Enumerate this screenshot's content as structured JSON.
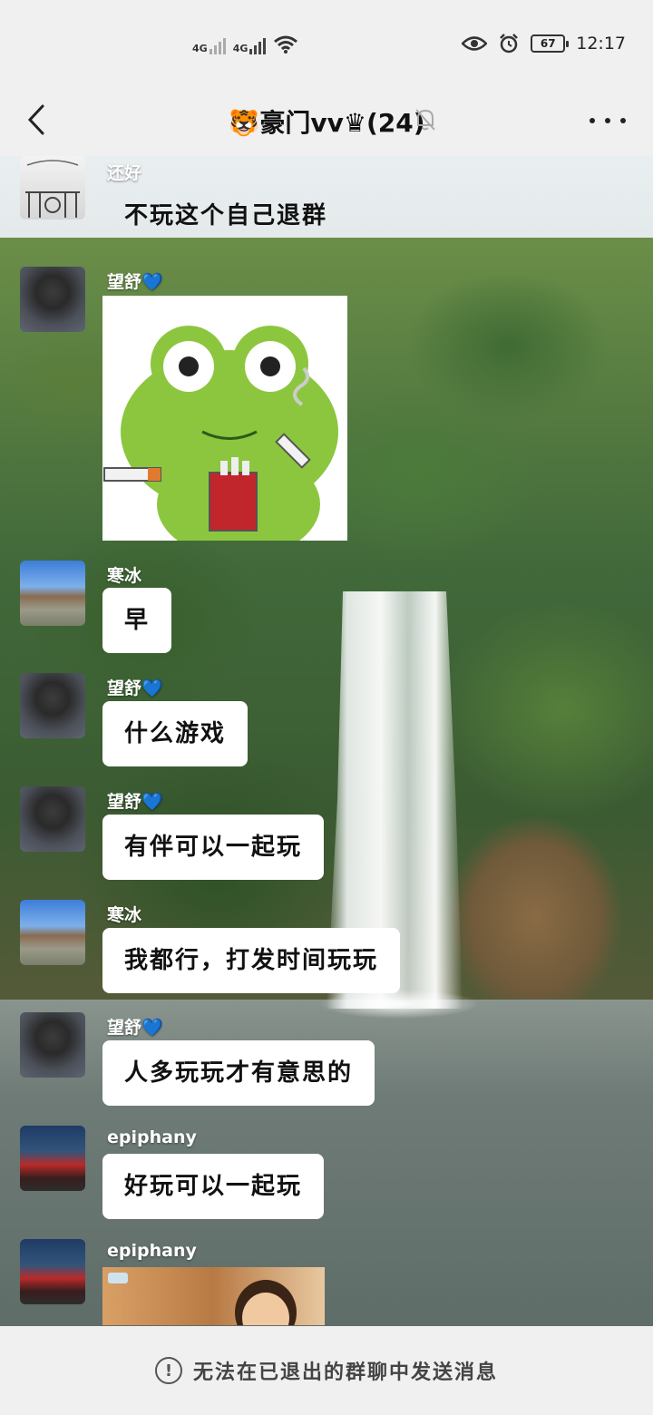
{
  "status_bar": {
    "network_1": "4G",
    "network_2": "4G",
    "battery": "67",
    "time": "12:17"
  },
  "header": {
    "title": "🐯豪门vv♛(24)"
  },
  "messages": [
    {
      "sender": "还好",
      "text": "不玩这个自己退群",
      "type": "text"
    },
    {
      "sender": "望舒💙",
      "type": "sticker"
    },
    {
      "sender": "寒冰",
      "text": "早",
      "type": "text"
    },
    {
      "sender": "望舒💙",
      "text": "什么游戏",
      "type": "text"
    },
    {
      "sender": "望舒💙",
      "text": "有伴可以一起玩",
      "type": "text"
    },
    {
      "sender": "寒冰",
      "text": "我都行，打发时间玩玩",
      "type": "text"
    },
    {
      "sender": "望舒💙",
      "text": "人多玩玩才有意思的",
      "type": "text"
    },
    {
      "sender": "epiphany",
      "text": "好玩可以一起玩",
      "type": "text"
    },
    {
      "sender": "epiphany",
      "type": "image"
    }
  ],
  "footer": {
    "notice": "无法在已退出的群聊中发送消息"
  }
}
